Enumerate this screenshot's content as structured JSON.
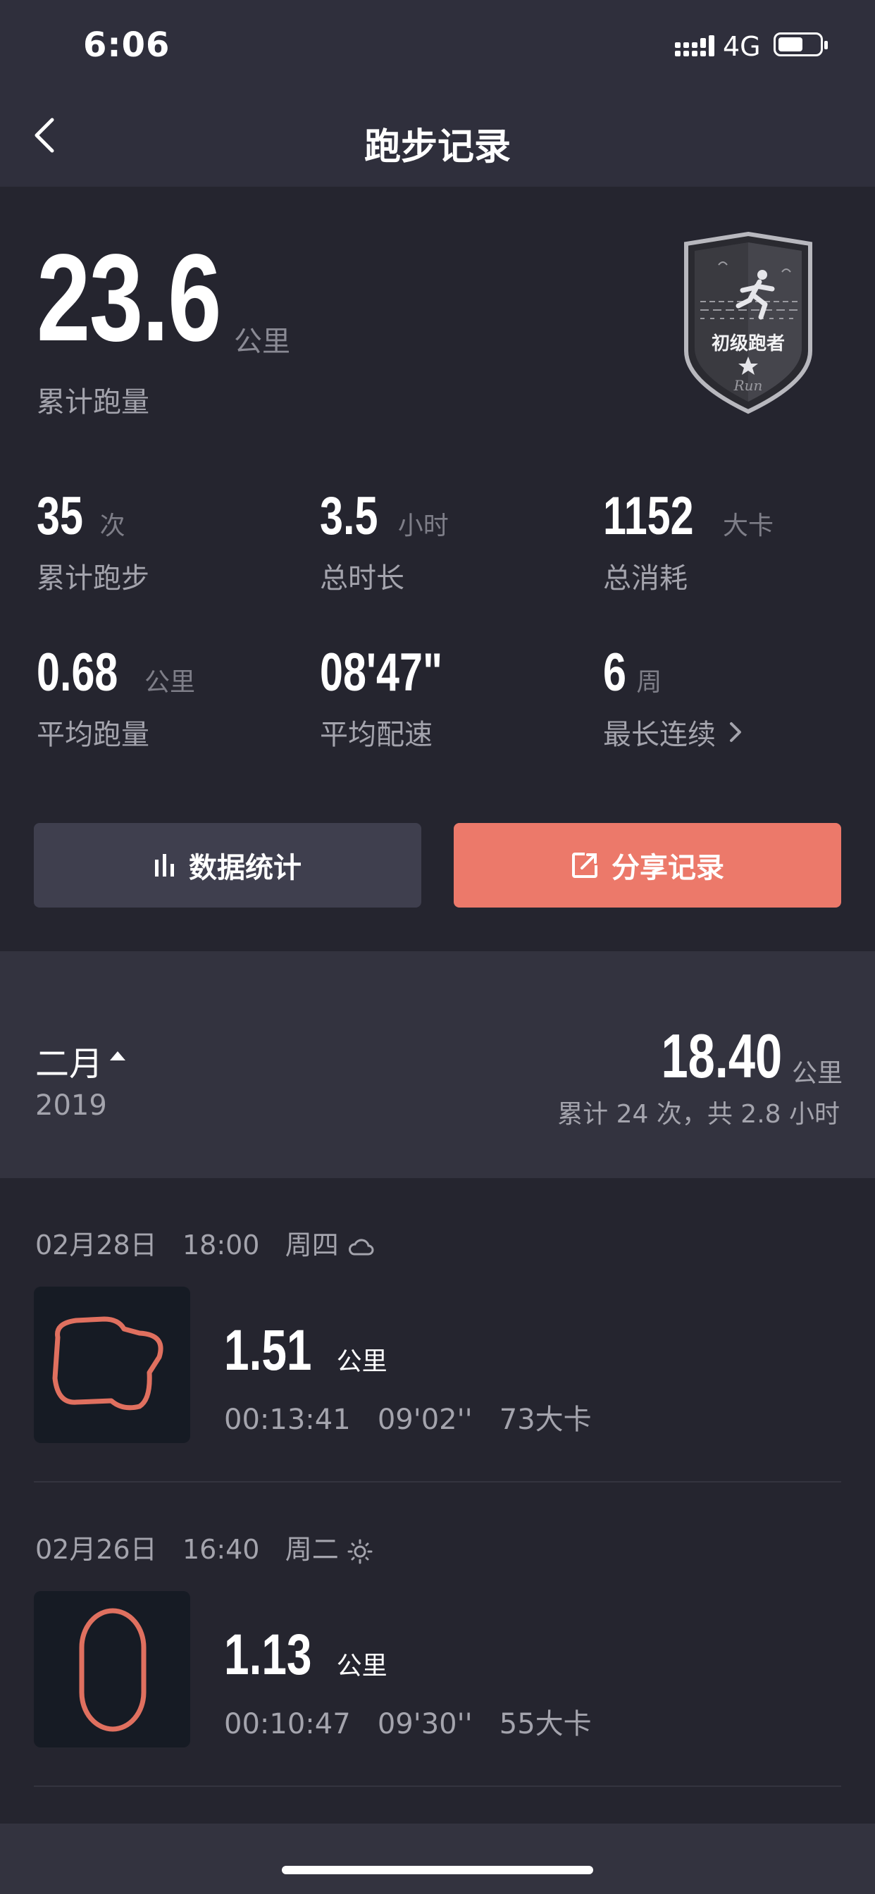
{
  "status_bar": {
    "time": "6:06",
    "network": "4G"
  },
  "nav": {
    "title": "跑步记录"
  },
  "summary": {
    "total_distance": "23.6",
    "total_unit": "公里",
    "total_label": "累计跑量",
    "badge_label": "初级跑者",
    "badge_script": "Run",
    "stats": [
      {
        "value": "35",
        "unit": "次",
        "label": "累计跑步"
      },
      {
        "value": "3.5",
        "unit": "小时",
        "label": "总时长"
      },
      {
        "value": "1152",
        "unit": "大卡",
        "label": "总消耗"
      },
      {
        "value": "0.68",
        "unit": "公里",
        "label": "平均跑量"
      },
      {
        "value": "08'47\"",
        "unit": "",
        "label": "平均配速"
      },
      {
        "value": "6",
        "unit": "周",
        "label": "最长连续"
      }
    ]
  },
  "buttons": {
    "stats": "数据统计",
    "share": "分享记录"
  },
  "month": {
    "name": "二月",
    "year": "2019",
    "distance": "18.40",
    "unit": "公里",
    "summary": "累计 24 次，共 2.8 小时"
  },
  "records": [
    {
      "date": "02月28日",
      "time": "18:00",
      "weekday": "周四",
      "weather_icon": "cloud-icon",
      "distance": "1.51",
      "unit": "公里",
      "duration": "00:13:41",
      "pace": "09'02''",
      "calories": "73大卡"
    },
    {
      "date": "02月26日",
      "time": "16:40",
      "weekday": "周二",
      "weather_icon": "sun-icon",
      "distance": "1.13",
      "unit": "公里",
      "duration": "00:10:47",
      "pace": "09'30''",
      "calories": "55大卡"
    }
  ],
  "colors": {
    "accent": "#ec796a",
    "background": "#25252f",
    "header": "#2f2f3c",
    "route": "#e0705f"
  }
}
